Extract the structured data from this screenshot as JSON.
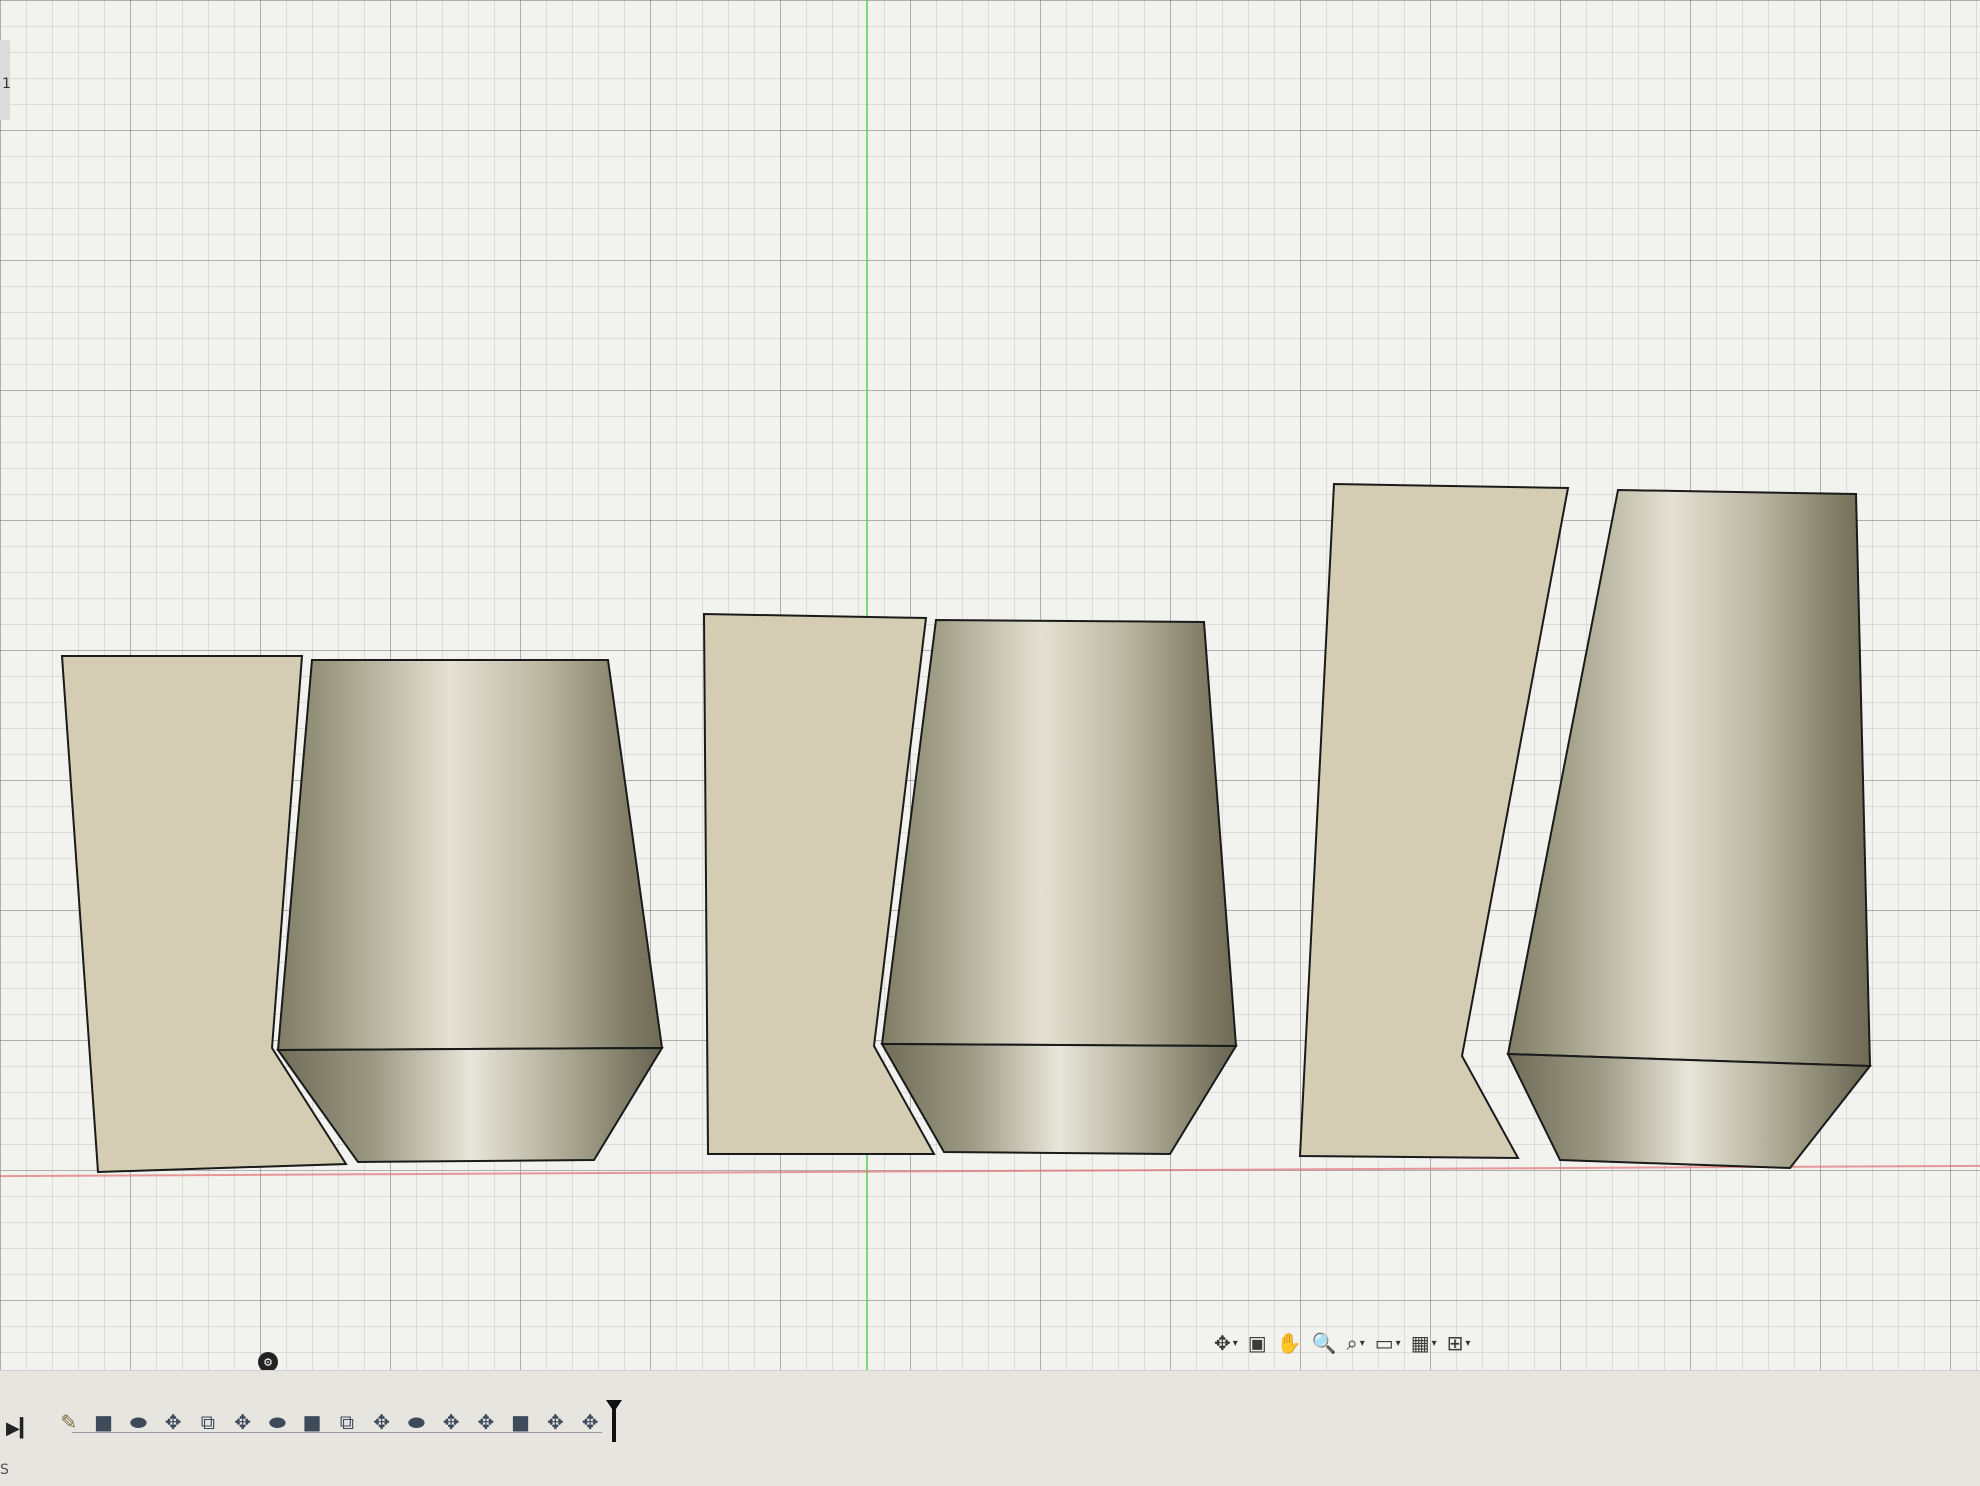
{
  "viewport": {
    "corner_label": "1"
  },
  "navigation_bar": {
    "tools": [
      {
        "icon": "orbit-icon",
        "glyph": "✥",
        "dropdown": true
      },
      {
        "icon": "look-at-icon",
        "glyph": "▣",
        "dropdown": false
      },
      {
        "icon": "pan-icon",
        "glyph": "✋",
        "dropdown": false
      },
      {
        "icon": "zoom-icon",
        "glyph": "🔍",
        "dropdown": false
      },
      {
        "icon": "fit-icon",
        "glyph": "⌕",
        "dropdown": true
      },
      {
        "icon": "display-settings-icon",
        "glyph": "▭",
        "dropdown": true
      },
      {
        "icon": "grid-settings-icon",
        "glyph": "▦",
        "dropdown": true
      },
      {
        "icon": "viewports-icon",
        "glyph": "⊞",
        "dropdown": true
      }
    ]
  },
  "timeline": {
    "settings_glyph": "⚙",
    "play_end_glyph": "▶▎",
    "features": [
      {
        "type": "sketch",
        "icon": "sketch-icon",
        "glyph": "✎"
      },
      {
        "type": "body",
        "icon": "extrude-icon",
        "glyph": "■"
      },
      {
        "type": "body",
        "icon": "loft-icon",
        "glyph": "⬬"
      },
      {
        "type": "move",
        "icon": "move-icon",
        "glyph": "✥"
      },
      {
        "type": "combine",
        "icon": "combine-icon",
        "glyph": "⧉"
      },
      {
        "type": "move",
        "icon": "move-icon",
        "glyph": "✥"
      },
      {
        "type": "body",
        "icon": "loft-icon",
        "glyph": "⬬"
      },
      {
        "type": "body",
        "icon": "extrude-icon",
        "glyph": "■"
      },
      {
        "type": "combine",
        "icon": "combine-icon",
        "glyph": "⧉"
      },
      {
        "type": "move",
        "icon": "move-icon",
        "glyph": "✥"
      },
      {
        "type": "body",
        "icon": "loft-icon",
        "glyph": "⬬"
      },
      {
        "type": "move",
        "icon": "move-icon",
        "glyph": "✥"
      },
      {
        "type": "move",
        "icon": "move-icon",
        "glyph": "✥"
      },
      {
        "type": "body",
        "icon": "extrude-icon",
        "glyph": "■"
      },
      {
        "type": "move",
        "icon": "move-icon",
        "glyph": "✥"
      },
      {
        "type": "move",
        "icon": "move-icon",
        "glyph": "✥"
      }
    ]
  },
  "status": {
    "text": "S"
  },
  "colors": {
    "body_fill": "#d4cdb3",
    "metal_dark": "#8e8a74",
    "metal_light": "#e4e1d3",
    "y_axis": "#5fce5f",
    "x_axis": "#e07a7a"
  }
}
